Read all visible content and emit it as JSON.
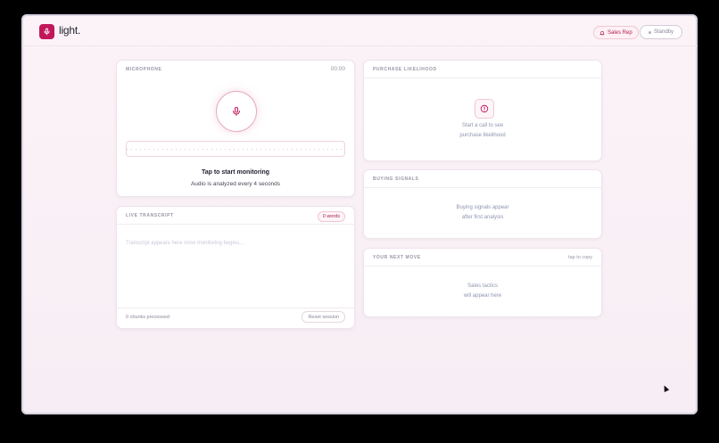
{
  "app": {
    "brand": "light.",
    "accent": "#c2185b"
  },
  "header": {
    "role_label": "Sales Rep",
    "status_label": "Standby"
  },
  "microphone": {
    "title": "MICROPHONE",
    "timer": "00:00",
    "prompt": "Tap to start monitoring",
    "subtext": "Audio is analyzed every 4 seconds"
  },
  "transcript": {
    "title": "LIVE TRANSCRIPT",
    "words": "0 words",
    "placeholder": "Transcript appears here once monitoring begins...",
    "chunks": "0 chunks processed",
    "reset_label": "Reset session"
  },
  "likelihood": {
    "title": "PURCHASE LIKELIHOOD",
    "line1": "Start a call to see",
    "line2": "purchase likelihood"
  },
  "signals": {
    "title": "BUYING SIGNALS",
    "line1": "Buying signals appear",
    "line2": "after first analysis"
  },
  "next_move": {
    "title": "YOUR NEXT MOVE",
    "hint": "tap to copy",
    "line1": "Sales tactics",
    "line2": "will appear here"
  }
}
